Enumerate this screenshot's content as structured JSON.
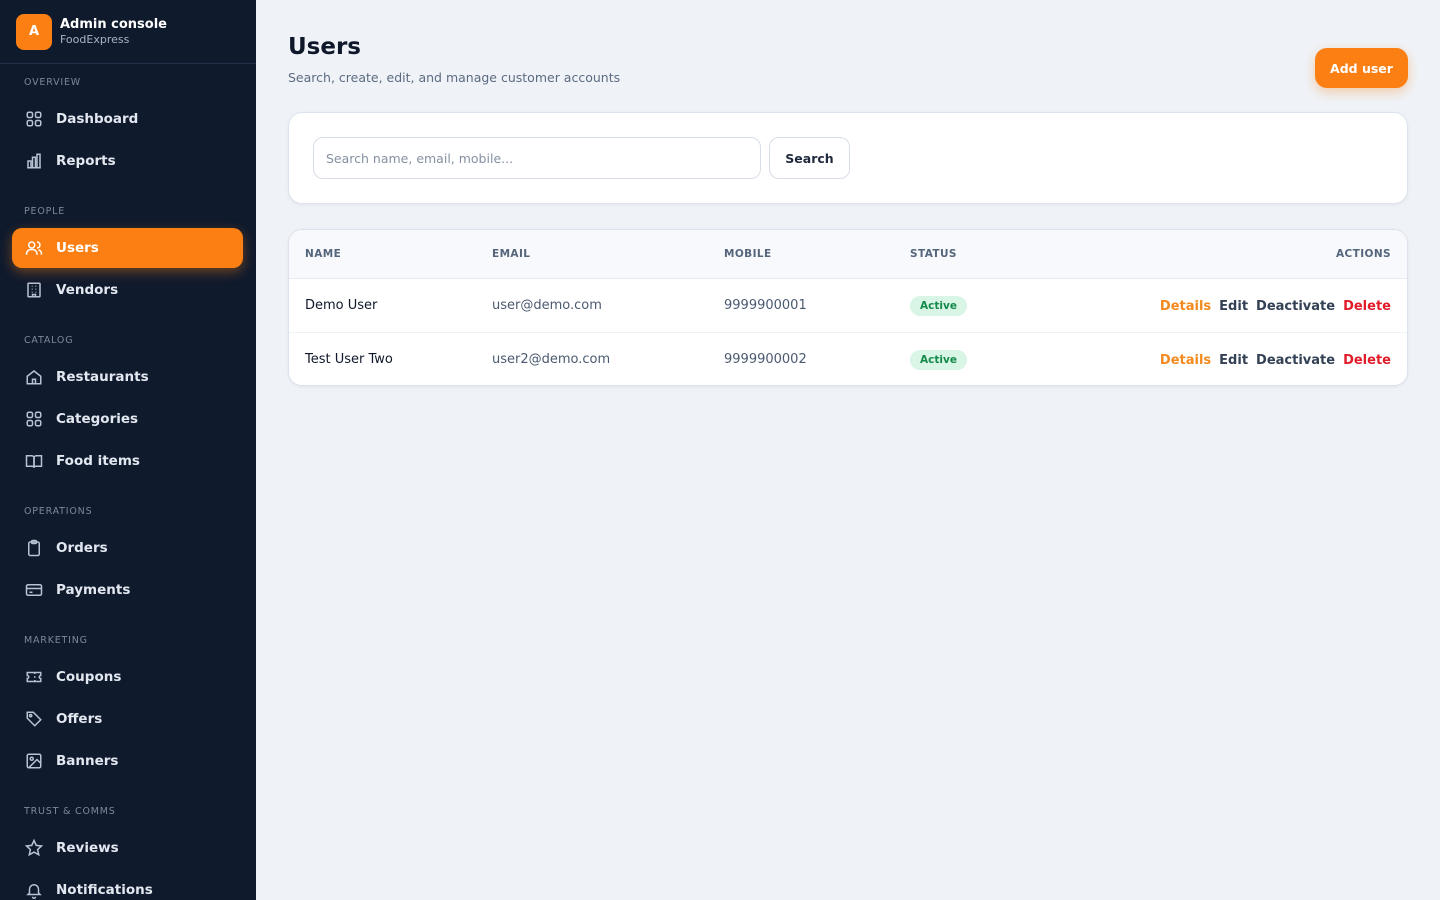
{
  "brand": {
    "logo_letter": "A",
    "title": "Admin console",
    "subtitle": "FoodExpress"
  },
  "sidebar": {
    "sections": [
      {
        "label": "OVERVIEW",
        "items": [
          {
            "label": "Dashboard",
            "icon": "grid-icon"
          },
          {
            "label": "Reports",
            "icon": "bar-chart-icon"
          }
        ]
      },
      {
        "label": "PEOPLE",
        "items": [
          {
            "label": "Users",
            "icon": "users-icon",
            "active": true
          },
          {
            "label": "Vendors",
            "icon": "building-icon"
          }
        ]
      },
      {
        "label": "CATALOG",
        "items": [
          {
            "label": "Restaurants",
            "icon": "home-icon"
          },
          {
            "label": "Categories",
            "icon": "grid-icon"
          },
          {
            "label": "Food items",
            "icon": "book-icon"
          }
        ]
      },
      {
        "label": "OPERATIONS",
        "items": [
          {
            "label": "Orders",
            "icon": "clipboard-icon"
          },
          {
            "label": "Payments",
            "icon": "credit-card-icon"
          }
        ]
      },
      {
        "label": "MARKETING",
        "items": [
          {
            "label": "Coupons",
            "icon": "ticket-icon"
          },
          {
            "label": "Offers",
            "icon": "tag-icon"
          },
          {
            "label": "Banners",
            "icon": "image-icon"
          }
        ]
      },
      {
        "label": "TRUST & COMMS",
        "items": [
          {
            "label": "Reviews",
            "icon": "star-icon"
          },
          {
            "label": "Notifications",
            "icon": "bell-icon"
          }
        ]
      }
    ]
  },
  "header": {
    "title": "Users",
    "subtitle": "Search, create, edit, and manage customer accounts",
    "add_button": "Add user"
  },
  "search": {
    "placeholder": "Search name, email, mobile...",
    "value": "",
    "button": "Search"
  },
  "table": {
    "columns": {
      "name": "NAME",
      "email": "EMAIL",
      "mobile": "MOBILE",
      "status": "STATUS",
      "actions": "ACTIONS"
    },
    "rows": [
      {
        "name": "Demo User",
        "email": "user@demo.com",
        "mobile": "9999900001",
        "status": "Active"
      },
      {
        "name": "Test User Two",
        "email": "user2@demo.com",
        "mobile": "9999900002",
        "status": "Active"
      }
    ],
    "actions": {
      "details": "Details",
      "edit": "Edit",
      "deactivate": "Deactivate",
      "delete": "Delete"
    }
  },
  "colors": {
    "accent": "#fb7f12",
    "sidebar_bg": "#0f1a2d",
    "page_bg": "#eff3f8",
    "status_active_bg": "#d9f5e5",
    "status_active_text": "#138a4a",
    "danger": "#e11d2a"
  }
}
